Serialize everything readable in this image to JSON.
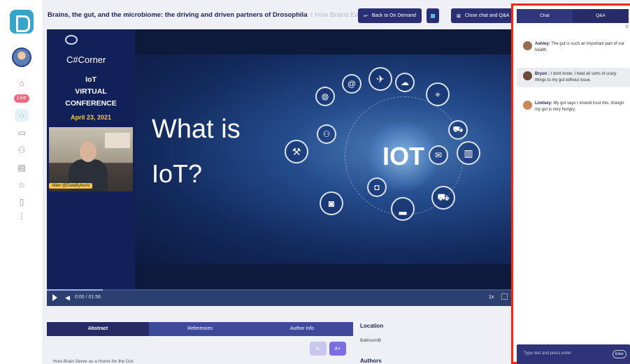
{
  "header": {
    "title": "Brains, the gut, and the microbiome: the driving and driven partners of Drosophila",
    "crumb_sep": "/",
    "crumb": "How Brains Eat G...",
    "back_label": "Back to On Demand",
    "close_label": "Close chat and Q&A"
  },
  "sidebar": {
    "live_badge": "Live"
  },
  "slide": {
    "brand": "C#Corner",
    "conf_line1": "IoT",
    "conf_line2": "VIRTUAL",
    "conf_line3": "CONFERENCE",
    "conf_date": "April 23, 2021",
    "speaker_tag": "Allen @DataBytesAI",
    "headline_line1": "What is",
    "headline_line2": "IoT?",
    "hub_label": "IOT"
  },
  "player": {
    "time": "0:00 / 01:56",
    "speed": "1x",
    "progress": 0.12
  },
  "tabs": [
    "Abstract",
    "References",
    "Author Info"
  ],
  "font_controls": {
    "smaller": "A-",
    "larger": "A+"
  },
  "abstract_preview": "How Brain Serve as a Home for the Gut",
  "details": {
    "location_label": "Location",
    "location_value": "BallroomB",
    "authors_label": "Authors"
  },
  "panel": {
    "tabs": [
      "Chat",
      "Q&A"
    ],
    "messages": [
      {
        "name": "Ashley:",
        "text": "The gut is such an important part of our health."
      },
      {
        "name": "Bryon :",
        "text": "I dont know, I feed all sorts of crazy things to my gut without issue."
      },
      {
        "name": "Lindsey:",
        "text": "My gut says I should trust this, though my gut is very hungry."
      }
    ],
    "composer_placeholder": "Type text and press enter",
    "enter_label": "Enter"
  }
}
